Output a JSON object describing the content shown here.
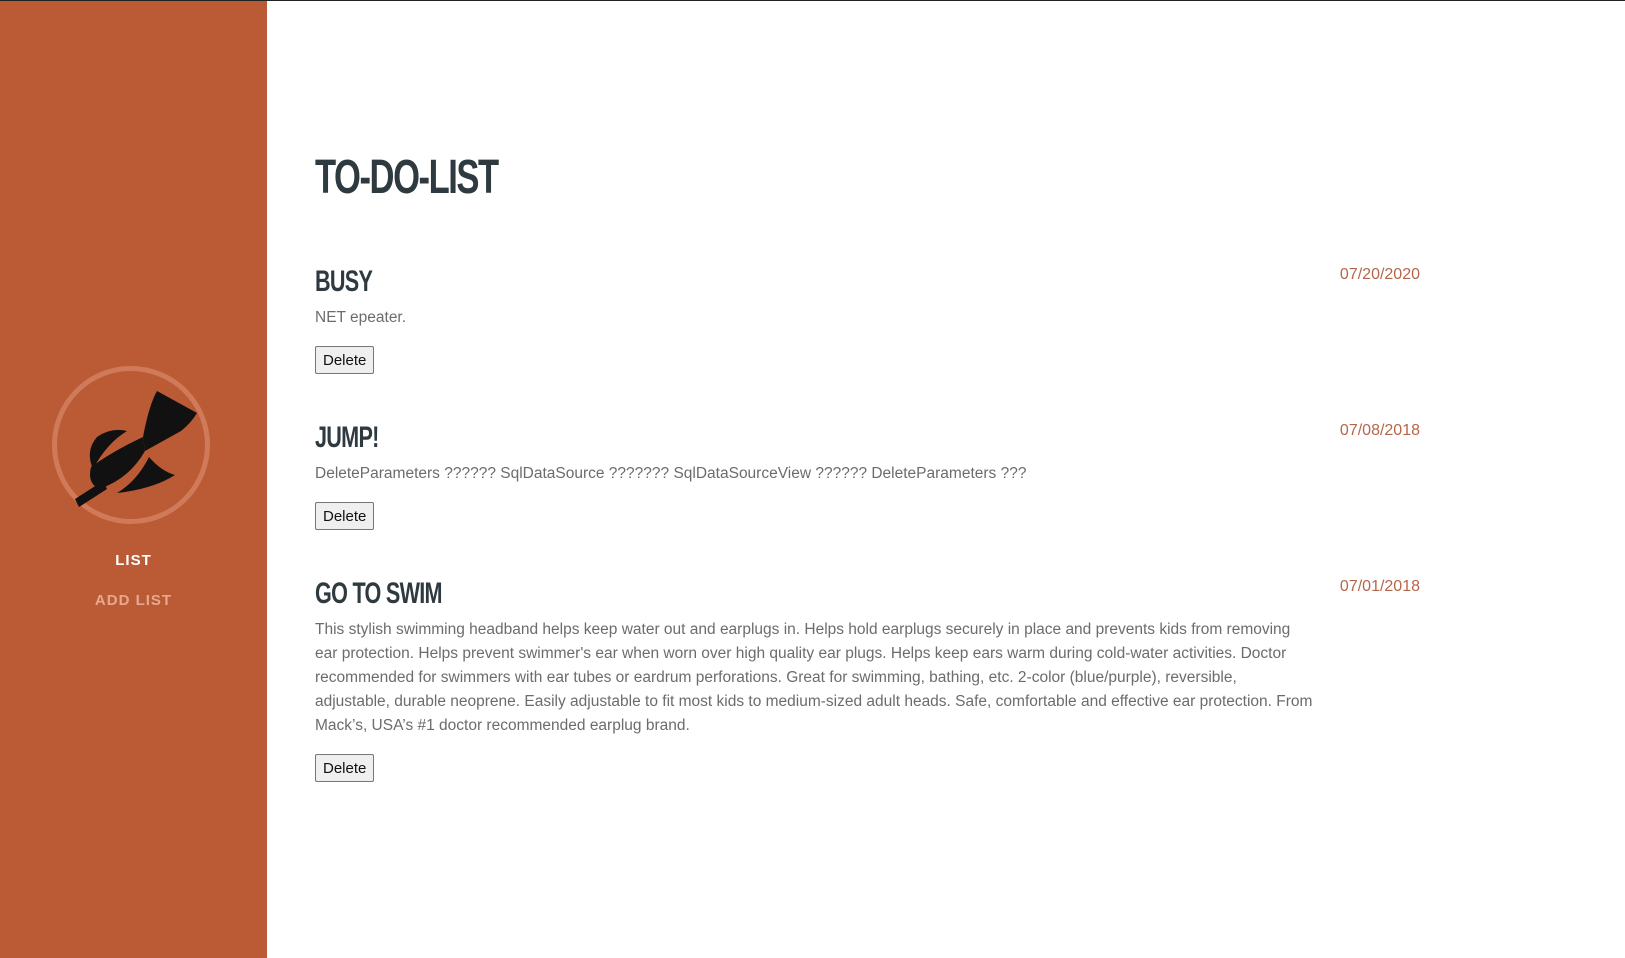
{
  "sidebar": {
    "logo_icon": "paddle-feather-icon",
    "nav": [
      {
        "label": "LIST",
        "active": true
      },
      {
        "label": "ADD LIST",
        "active": false
      }
    ]
  },
  "main": {
    "title": "TO-DO-LIST",
    "items": [
      {
        "title": "BUSY",
        "date": "07/20/2020",
        "description": "NET epeater.",
        "delete_label": "Delete"
      },
      {
        "title": "JUMP!",
        "date": "07/08/2018",
        "description": "DeleteParameters ?????? SqlDataSource ??????? SqlDataSourceView ?????? DeleteParameters ???",
        "delete_label": "Delete"
      },
      {
        "title": "GO TO SWIM",
        "date": "07/01/2018",
        "description": "This stylish swimming headband helps keep water out and earplugs in. Helps hold earplugs securely in place and prevents kids from removing ear protection. Helps prevent swimmer's ear when worn over high quality ear plugs. Helps keep ears warm during cold-water activities. Doctor recommended for swimmers with ear tubes or eardrum perforations. Great for swimming, bathing, etc. 2-color (blue/purple), reversible, adjustable, durable neoprene. Easily adjustable to fit most kids to medium-sized adult heads. Safe, comfortable and effective ear protection. From Mack’s, USA’s #1 doctor recommended earplug brand.",
        "delete_label": "Delete"
      }
    ]
  },
  "colors": {
    "sidebar_bg": "#bb5b36",
    "accent_date": "#b5664a",
    "title_text": "#2f3a40"
  }
}
